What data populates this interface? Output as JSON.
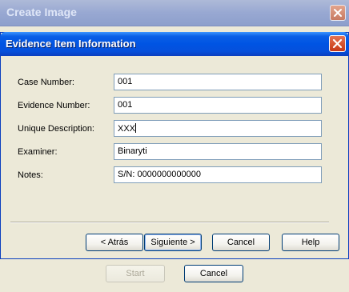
{
  "background_window": {
    "title": "Create Image",
    "start_label": "Start",
    "cancel_label": "Cancel"
  },
  "dialog": {
    "title": "Evidence Item Information",
    "fields": [
      {
        "label": "Case Number:",
        "value": "001"
      },
      {
        "label": "Evidence Number:",
        "value": "001"
      },
      {
        "label": "Unique Description:",
        "value": "XXX"
      },
      {
        "label": "Examiner:",
        "value": "Binaryti"
      },
      {
        "label": "Notes:",
        "value": "S/N: 0000000000000"
      }
    ],
    "buttons": {
      "back": "< Atrás",
      "next": "Siguiente >",
      "cancel": "Cancel",
      "help": "Help"
    }
  },
  "colors": {
    "titlebar_active": "#0054e3",
    "titlebar_inactive": "#98a8d2",
    "window_bg": "#ece9d8",
    "field_border": "#7f9db9",
    "close_button": "#d34f2a"
  }
}
